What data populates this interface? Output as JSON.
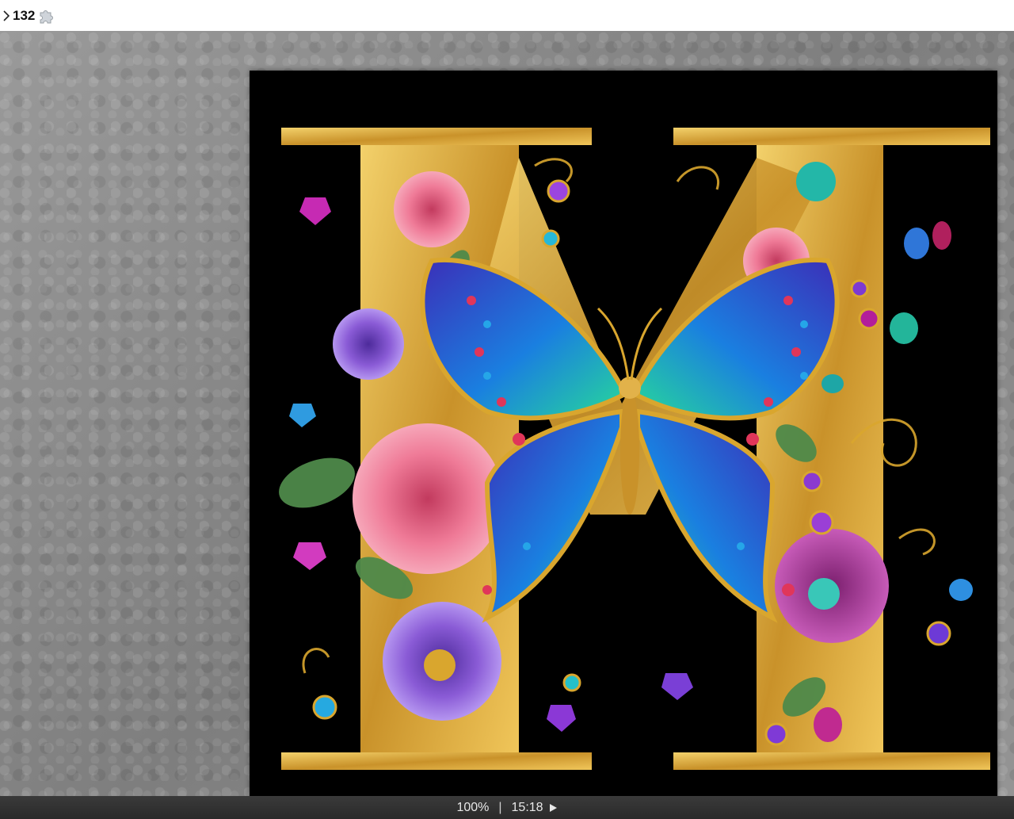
{
  "header": {
    "piece_count": "132",
    "expand_icon": "chevron-right-icon",
    "piece_icon": "puzzle-piece-icon"
  },
  "status": {
    "zoom": "100%",
    "separator": "|",
    "timer": "15:18",
    "play_icon": "play-icon"
  },
  "colors": {
    "gold": "#d9a62e",
    "rose_pink": "#e8607f",
    "violet": "#8a5bd6",
    "teal": "#23c2b4",
    "blue": "#2a5fd0",
    "board_gray": "#8c8c8c",
    "status_bg": "#2f2f2f"
  }
}
